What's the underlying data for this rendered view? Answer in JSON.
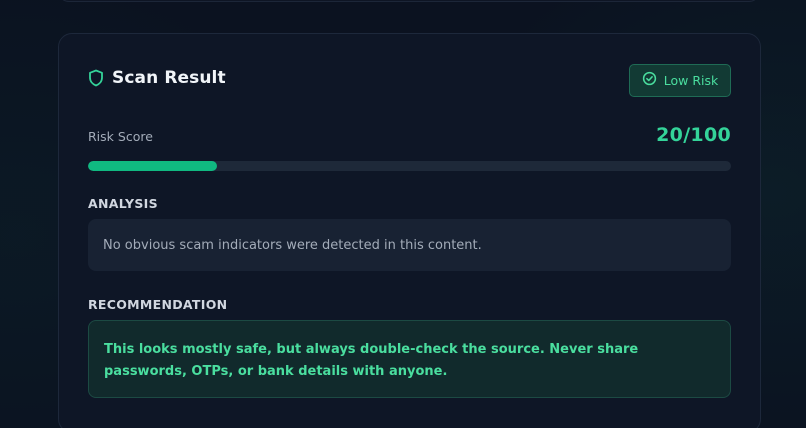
{
  "card": {
    "title": "Scan Result",
    "badge_label": "Low Risk",
    "risk_score_label": "Risk Score",
    "risk_score_value": "20/100",
    "risk_score_fraction": 0.2,
    "analysis_heading": "ANALYSIS",
    "analysis_text": "No obvious scam indicators were detected in this content.",
    "recommendation_heading": "RECOMMENDATION",
    "recommendation_text": "This looks mostly safe, but always double-check the source. Never share passwords, OTPs, or bank details with anyone."
  },
  "icons": {
    "title_icon": "shield-icon",
    "badge_icon": "check-circle-icon"
  },
  "colors": {
    "accent": "#10b981",
    "accent_text": "#34d399",
    "badge_bg": "#123a34",
    "card_bg": "#0e1626"
  }
}
